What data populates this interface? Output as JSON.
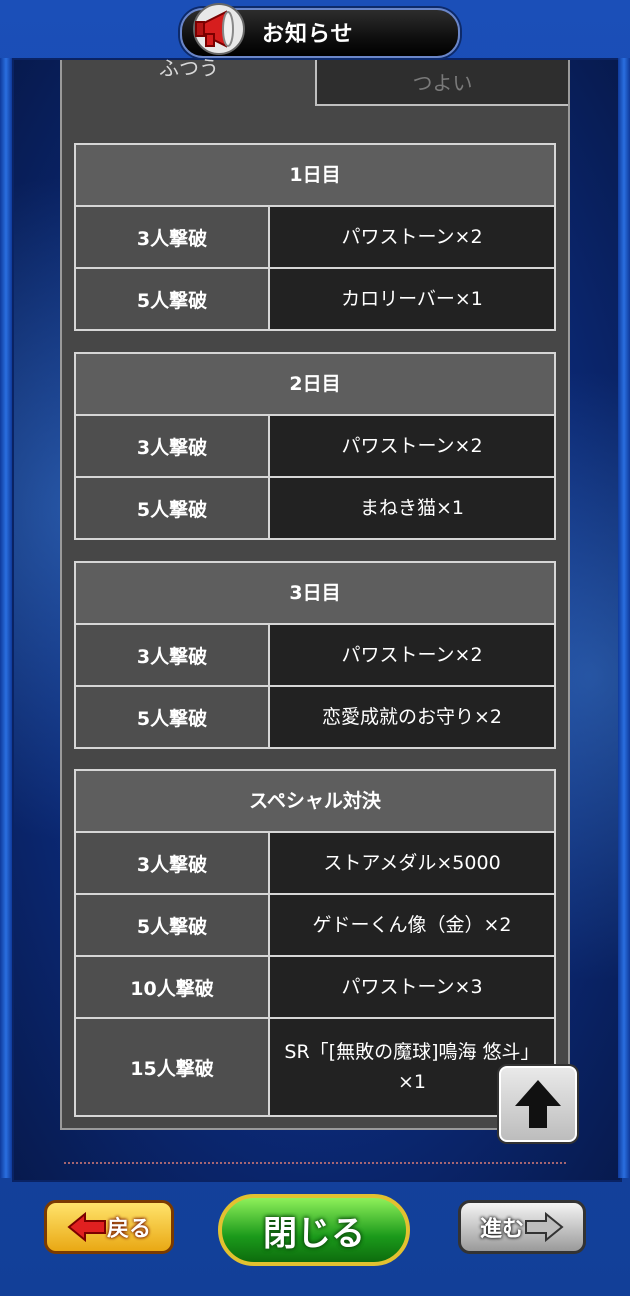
{
  "header": {
    "title": "お知らせ"
  },
  "tabs": [
    {
      "label": "ふつう",
      "active": true
    },
    {
      "label": "つよい",
      "active": false
    }
  ],
  "sections": [
    {
      "title": "1日目",
      "rows": [
        {
          "condition": "3人撃破",
          "reward": "パワストーン×2"
        },
        {
          "condition": "5人撃破",
          "reward": "カロリーバー×1"
        }
      ]
    },
    {
      "title": "2日目",
      "rows": [
        {
          "condition": "3人撃破",
          "reward": "パワストーン×2"
        },
        {
          "condition": "5人撃破",
          "reward": "まねき猫×1"
        }
      ]
    },
    {
      "title": "3日目",
      "rows": [
        {
          "condition": "3人撃破",
          "reward": "パワストーン×2"
        },
        {
          "condition": "5人撃破",
          "reward": "恋愛成就のお守り×2"
        }
      ]
    },
    {
      "title": "スペシャル対決",
      "rows": [
        {
          "condition": "3人撃破",
          "reward": "ストアメダル×5000"
        },
        {
          "condition": "5人撃破",
          "reward": "ゲドーくん像（金）×2"
        },
        {
          "condition": "10人撃破",
          "reward": "パワストーン×3"
        },
        {
          "condition": "15人撃破",
          "reward": "SR「[無敗の魔球]鳴海 悠斗」×1"
        }
      ]
    }
  ],
  "footer": {
    "back_label": "戻る",
    "close_label": "閉じる",
    "next_label": "進む"
  },
  "icons": {
    "megaphone": "megaphone-icon",
    "scroll_top": "arrow-up-icon",
    "back_arrow": "arrow-left-icon",
    "next_arrow": "arrow-right-icon"
  },
  "colors": {
    "frame_blue": "#1b4fb8",
    "panel_gray": "#474747",
    "close_green": "#1b9a1b",
    "back_yellow": "#e9a814"
  }
}
